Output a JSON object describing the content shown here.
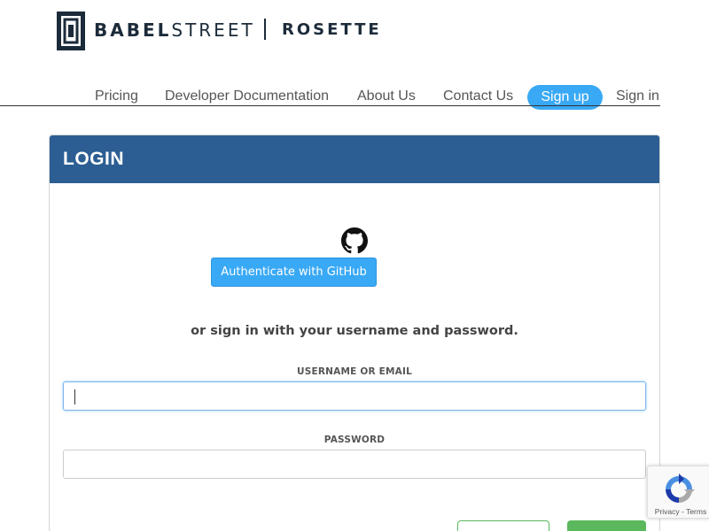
{
  "header": {
    "brand_part1": "BABEL",
    "brand_part2": "STREET",
    "product": "ROSETTE"
  },
  "nav": {
    "items": [
      {
        "label": "Pricing"
      },
      {
        "label": "Developer Documentation"
      },
      {
        "label": "About Us"
      },
      {
        "label": "Contact Us"
      },
      {
        "label": "Sign up"
      },
      {
        "label": "Sign in"
      }
    ],
    "signup_color": "#39a9f5"
  },
  "login": {
    "title": "LOGIN",
    "header_color": "#2c5e93",
    "github_icon": "github-icon",
    "github_button": "Authenticate with GitHub",
    "alt_text": "or sign in with your username and password.",
    "username_label": "USERNAME OR EMAIL",
    "username_value": "",
    "password_label": "PASSWORD",
    "password_value": "",
    "button_color": "#5cb85c"
  },
  "recaptcha": {
    "icon": "recaptcha-icon",
    "privacy": "Privacy",
    "separator": " - ",
    "terms": "Terms"
  }
}
